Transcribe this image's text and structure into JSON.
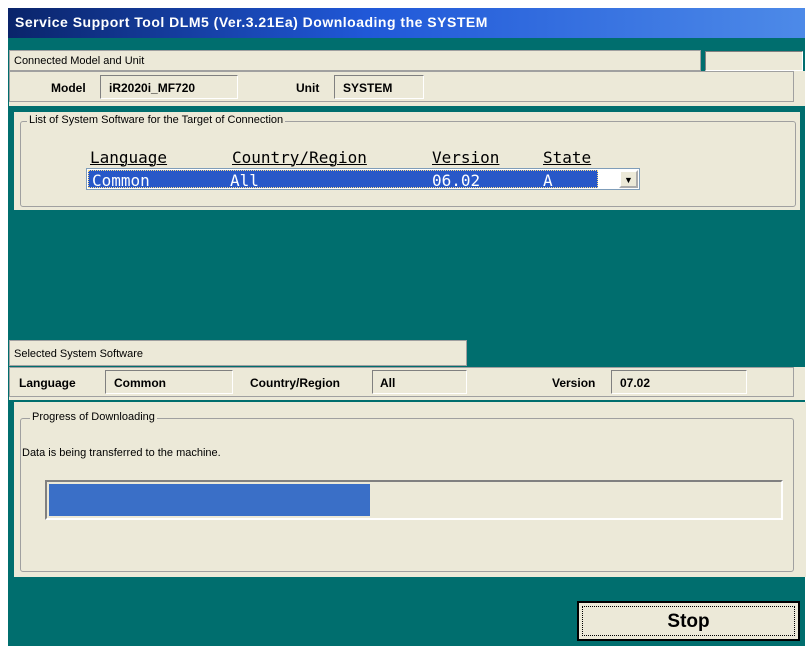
{
  "window": {
    "title": "Service Support Tool DLM5 (Ver.3.21Ea) Downloading the SYSTEM"
  },
  "connected": {
    "header": "Connected Model and Unit",
    "model_label": "Model",
    "model_value": "iR2020i_MF720",
    "unit_label": "Unit",
    "unit_value": "SYSTEM"
  },
  "system_list": {
    "group_label": "List of System Software for the Target of Connection",
    "columns": [
      "Language",
      "Country/Region",
      "Version",
      "State"
    ],
    "selected_row": {
      "language": "Common",
      "country": "All",
      "version": "06.02",
      "state": "A"
    },
    "dropdown_icon": "chevron-down-icon"
  },
  "selected_software": {
    "header": "Selected System Software",
    "language_label": "Language",
    "language_value": "Common",
    "country_label": "Country/Region",
    "country_value": "All",
    "version_label": "Version",
    "version_value": "07.02"
  },
  "progress": {
    "group_label": "Progress of Downloading",
    "status_text": "Data is being transferred to the machine.",
    "fraction": 0.44,
    "bar_color": "#3a6fc7"
  },
  "actions": {
    "stop_label": "Stop"
  },
  "colors": {
    "background": "#006e6e",
    "panel": "#ece9d8",
    "selection": "#2858c8"
  }
}
